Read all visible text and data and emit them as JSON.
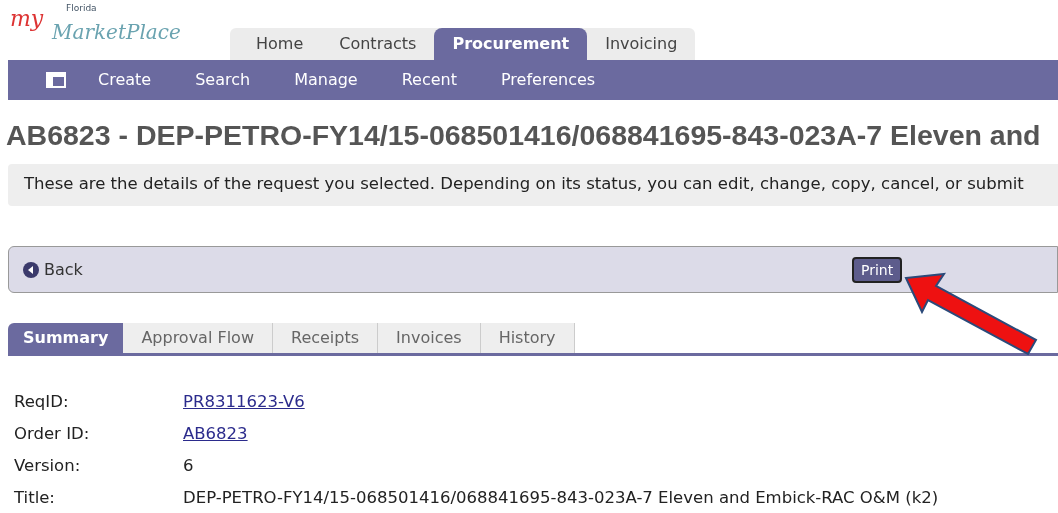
{
  "logo": {
    "prefix": "my",
    "state": "Florida",
    "name": "MarketPlace"
  },
  "main_tabs": [
    {
      "label": "Home",
      "selected": false
    },
    {
      "label": "Contracts",
      "selected": false
    },
    {
      "label": "Procurement",
      "selected": true
    },
    {
      "label": "Invoicing",
      "selected": false
    }
  ],
  "sub_nav": [
    "Create",
    "Search",
    "Manage",
    "Recent",
    "Preferences"
  ],
  "page_title": "AB6823 - DEP-PETRO-FY14/15-068501416/068841695-843-023A-7 Eleven and",
  "info_message": "These are the details of the request you selected. Depending on its status, you can edit, change, copy, cancel, or submit",
  "action_bar": {
    "back": "Back",
    "print": "Print"
  },
  "detail_tabs": [
    {
      "label": "Summary",
      "selected": true
    },
    {
      "label": "Approval Flow",
      "selected": false
    },
    {
      "label": "Receipts",
      "selected": false
    },
    {
      "label": "Invoices",
      "selected": false
    },
    {
      "label": "History",
      "selected": false
    }
  ],
  "fields": [
    {
      "label": "ReqID:",
      "value": "PR8311623-V6",
      "kind": "link"
    },
    {
      "label": "Order ID:",
      "value": "AB6823",
      "kind": "link"
    },
    {
      "label": "Version:",
      "value": "6",
      "kind": "text"
    },
    {
      "label": "Title:",
      "value": "DEP-PETRO-FY14/15-068501416/068841695-843-023A-7 Eleven and Embick-RAC O&M (k2)",
      "kind": "text"
    }
  ]
}
